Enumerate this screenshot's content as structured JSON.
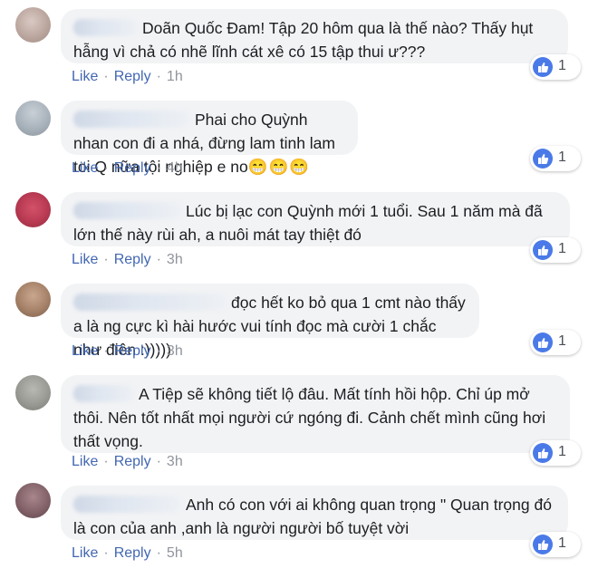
{
  "colors": {
    "link": "#4267b2",
    "meta": "#90949c",
    "bubble": "#f2f3f5",
    "like": "#4a7ae8"
  },
  "comments": [
    {
      "text": "Doãn Quốc Đam! Tập 20 hôm qua là thế nào? Thấy hụt hẫng vì chả có nhẽ lĩnh cát xê có 15 tập thui ư???",
      "like": "Like",
      "reply": "Reply",
      "time": "1h",
      "reactions": "1"
    },
    {
      "text": "Phai cho Quỳnh nhan con đi a nhá, đừng lam tinh lam toi Q nữa tội nghiệp e no",
      "emoji": "😁😁😁",
      "like": "Like",
      "reply": "Reply",
      "time": "4h",
      "reactions": "1"
    },
    {
      "text": "Lúc bị lạc con Quỳnh mới 1 tuổi. Sau 1 năm mà đã lớn thế này rùi ah, a nuôi mát tay thiệt đó",
      "like": "Like",
      "reply": "Reply",
      "time": "3h",
      "reactions": "1"
    },
    {
      "text": "đọc hết ko bỏ qua 1 cmt nào thấy a là ng cực kì hài hước vui tính đọc mà cười 1 chắc như điên :)))))",
      "like": "Like",
      "reply": "Reply",
      "time": "3h",
      "reactions": "1"
    },
    {
      "text": "A Tiệp sẽ không tiết lộ đâu. Mất tính hồi hộp. Chỉ úp mở thôi. Nên tốt nhất mọi người cứ ngóng đi. Cảnh chết mình cũng hơi thất vọng.",
      "like": "Like",
      "reply": "Reply",
      "time": "3h",
      "reactions": "1"
    },
    {
      "text": "Anh có con với ai không quan trọng \" Quan trọng đó là con của anh ,anh là người người bố tuyệt vời",
      "like": "Like",
      "reply": "Reply",
      "time": "5h",
      "reactions": "1"
    }
  ]
}
